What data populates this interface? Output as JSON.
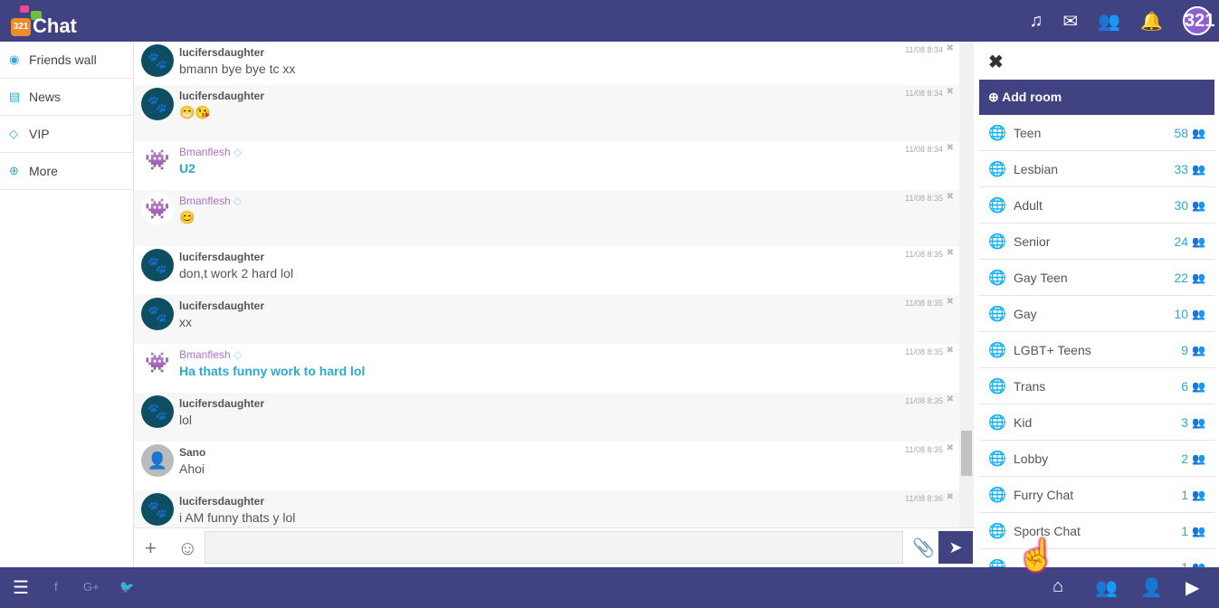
{
  "header": {
    "logo_text": "Chat",
    "logo_badge": "321",
    "icons": [
      "music-icon",
      "envelope-icon",
      "users-icon",
      "bell-icon"
    ],
    "avatar": "321"
  },
  "sidebar": {
    "items": [
      {
        "label": "Friends wall",
        "icon": "rss-icon"
      },
      {
        "label": "News",
        "icon": "newspaper-icon"
      },
      {
        "label": "VIP",
        "icon": "diamond-icon"
      },
      {
        "label": "More",
        "icon": "plus-circle-icon"
      }
    ]
  },
  "messages": [
    {
      "user": "lucifersdaughter",
      "text": "bmann bye bye tc xx",
      "time": "11/08 8:34",
      "avatar": "paw"
    },
    {
      "user": "lucifersdaughter",
      "text": "😁😘",
      "time": "11/08 8:34",
      "avatar": "paw",
      "emoji": true
    },
    {
      "user": "Bmanflesh",
      "text": "U2",
      "time": "11/08 8:34",
      "avatar": "monster",
      "vip": true
    },
    {
      "user": "Bmanflesh",
      "text": "😊",
      "time": "11/08 8:35",
      "avatar": "monster",
      "vip": true,
      "emoji": true
    },
    {
      "user": "lucifersdaughter",
      "text": "don,t work 2 hard lol",
      "time": "11/08 8:35",
      "avatar": "paw"
    },
    {
      "user": "lucifersdaughter",
      "text": "xx",
      "time": "11/08 8:35",
      "avatar": "paw"
    },
    {
      "user": "Bmanflesh",
      "text": "Ha thats funny work to hard lol",
      "time": "11/08 8:35",
      "avatar": "monster",
      "vip": true
    },
    {
      "user": "lucifersdaughter",
      "text": "lol",
      "time": "11/08 8:35",
      "avatar": "paw"
    },
    {
      "user": "Sano",
      "text": "Ahoi",
      "time": "11/08 8:35",
      "avatar": "default"
    },
    {
      "user": "lucifersdaughter",
      "text": "i AM funny thats y lol",
      "time": "11/08 8:36",
      "avatar": "paw"
    }
  ],
  "input": {
    "placeholder": "",
    "value": ""
  },
  "rooms_panel": {
    "add_room_label": "Add room",
    "rooms": [
      {
        "name": "Teen",
        "count": "58"
      },
      {
        "name": "Lesbian",
        "count": "33"
      },
      {
        "name": "Adult",
        "count": "30"
      },
      {
        "name": "Senior",
        "count": "24"
      },
      {
        "name": "Gay Teen",
        "count": "22"
      },
      {
        "name": "Gay",
        "count": "10"
      },
      {
        "name": "LGBT+ Teens",
        "count": "9"
      },
      {
        "name": "Trans",
        "count": "6"
      },
      {
        "name": "Kid",
        "count": "3"
      },
      {
        "name": "Lobby",
        "count": "2"
      },
      {
        "name": "Furry Chat",
        "count": "1"
      },
      {
        "name": "Sports Chat",
        "count": "1"
      },
      {
        "name": "",
        "count": "1"
      }
    ]
  },
  "footer": {
    "social": [
      "facebook-icon",
      "google-plus-icon",
      "twitter-icon"
    ],
    "right_icons": [
      "home-icon",
      "users-icon",
      "add-user-icon",
      "video-icon"
    ]
  },
  "colors": {
    "brand": "#414281",
    "accent": "#2aa9d2"
  }
}
